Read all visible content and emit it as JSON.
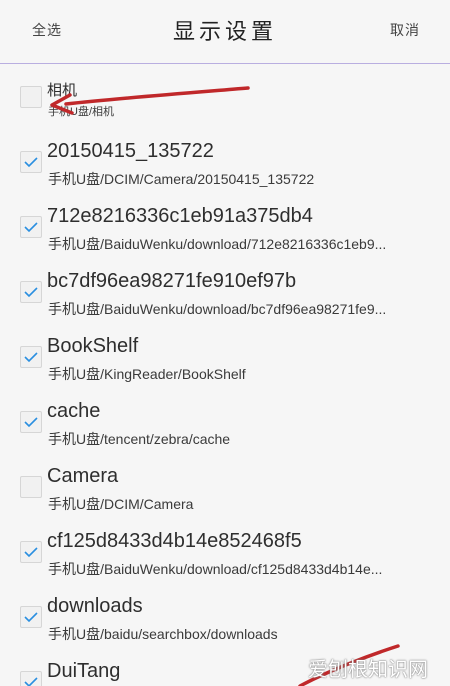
{
  "header": {
    "select_all": "全选",
    "title": "显示设置",
    "cancel": "取消"
  },
  "items": [
    {
      "name": "相机",
      "path": "手机U盘/相机",
      "checked": false
    },
    {
      "name": "20150415_135722",
      "path": "手机U盘/DCIM/Camera/20150415_135722",
      "checked": true
    },
    {
      "name": "712e8216336c1eb91a375db4",
      "path": "手机U盘/BaiduWenku/download/712e8216336c1eb9...",
      "checked": true
    },
    {
      "name": "bc7df96ea98271fe910ef97b",
      "path": "手机U盘/BaiduWenku/download/bc7df96ea98271fe9...",
      "checked": true
    },
    {
      "name": "BookShelf",
      "path": "手机U盘/KingReader/BookShelf",
      "checked": true
    },
    {
      "name": "cache",
      "path": "手机U盘/tencent/zebra/cache",
      "checked": true
    },
    {
      "name": "Camera",
      "path": "手机U盘/DCIM/Camera",
      "checked": false
    },
    {
      "name": "cf125d8433d4b14e852468f5",
      "path": "手机U盘/BaiduWenku/download/cf125d8433d4b14e...",
      "checked": true
    },
    {
      "name": "downloads",
      "path": "手机U盘/baidu/searchbox/downloads",
      "checked": true
    },
    {
      "name": "DuiTang",
      "path": "",
      "checked": true
    }
  ],
  "watermark": "爱刨根知识网",
  "colors": {
    "check": "#2a8fe0",
    "arrow": "#c0282a",
    "header_border": "#b9aee0"
  },
  "icons": {
    "check": "checkmark-icon"
  }
}
